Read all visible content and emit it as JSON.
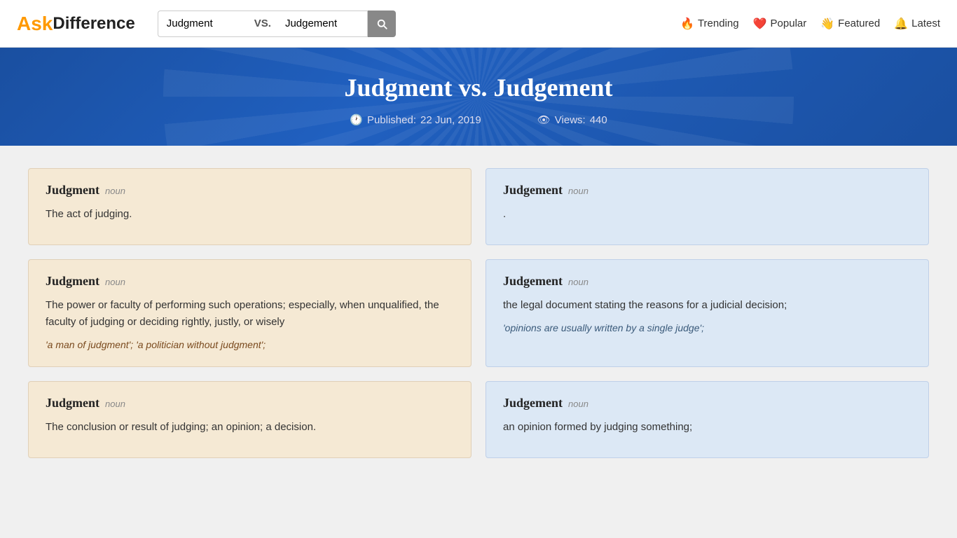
{
  "logo": {
    "ask": "Ask",
    "diff": "Difference"
  },
  "search": {
    "term1": "Judgment",
    "term2": "Judgement",
    "vs": "VS.",
    "btn_label": "Search"
  },
  "nav": {
    "items": [
      {
        "id": "trending",
        "emoji": "🔥",
        "label": "Trending"
      },
      {
        "id": "popular",
        "emoji": "❤️",
        "label": "Popular"
      },
      {
        "id": "featured",
        "emoji": "👋",
        "label": "Featured"
      },
      {
        "id": "latest",
        "emoji": "🔔",
        "label": "Latest"
      }
    ]
  },
  "hero": {
    "title": "Judgment vs. Judgement",
    "published_label": "Published:",
    "published_date": "22 Jun, 2019",
    "views_label": "Views:",
    "views_count": "440"
  },
  "cards": [
    {
      "side": "left",
      "word": "Judgment",
      "pos": "noun",
      "text": "The act of judging.",
      "example": ""
    },
    {
      "side": "right",
      "word": "Judgement",
      "pos": "noun",
      "text": ".",
      "example": ""
    },
    {
      "side": "left",
      "word": "Judgment",
      "pos": "noun",
      "text": "The power or faculty of performing such operations; especially, when unqualified, the faculty of judging or deciding rightly, justly, or wisely",
      "example": "'a man of judgment';  'a politician without judgment';"
    },
    {
      "side": "right",
      "word": "Judgement",
      "pos": "noun",
      "text": "the legal document stating the reasons for a judicial decision;",
      "example": "'opinions are usually written by a single judge';"
    },
    {
      "side": "left",
      "word": "Judgment",
      "pos": "noun",
      "text": "The conclusion or result of judging; an opinion; a decision.",
      "example": ""
    },
    {
      "side": "right",
      "word": "Judgement",
      "pos": "noun",
      "text": "an opinion formed by judging something;",
      "example": ""
    }
  ]
}
